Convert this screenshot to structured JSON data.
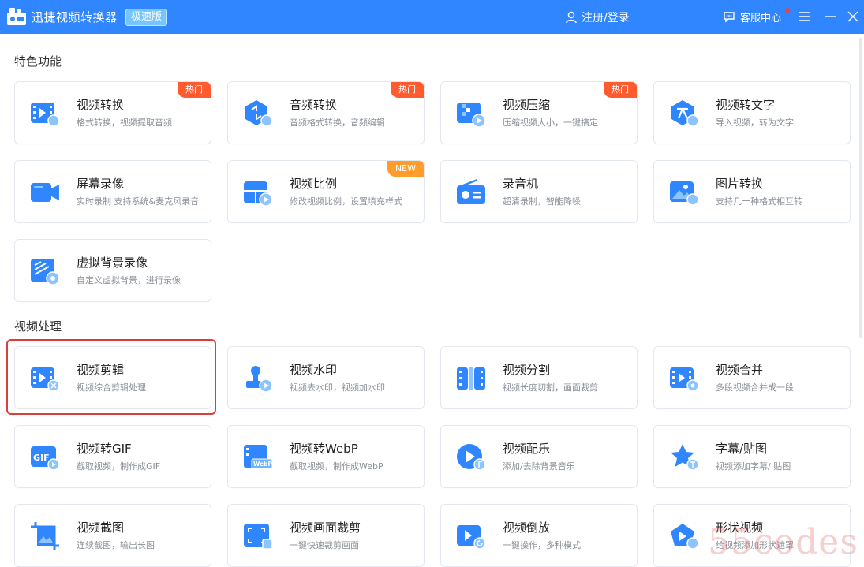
{
  "app": {
    "title": "迅捷视频转换器",
    "edition_badge": "极速版"
  },
  "header": {
    "login_label": "注册/登录",
    "support_label": "客服中心"
  },
  "sections": {
    "featured": "特色功能",
    "processing": "视频处理"
  },
  "tags": {
    "hot": "热门",
    "new": "NEW"
  },
  "featured": [
    {
      "title": "视频转换",
      "desc": "格式转换，视频提取音频"
    },
    {
      "title": "音频转换",
      "desc": "音频格式转换，音频编辑"
    },
    {
      "title": "视频压缩",
      "desc": "压缩视频大小，一键搞定"
    },
    {
      "title": "视频转文字",
      "desc": "导入视频，转为文字"
    },
    {
      "title": "屏幕录像",
      "desc": "实时录制 支持系统&麦克风录音"
    },
    {
      "title": "视频比例",
      "desc": "修改视频比例，设置填充样式"
    },
    {
      "title": "录音机",
      "desc": "超清录制，智能降噪"
    },
    {
      "title": "图片转换",
      "desc": "支持几十种格式相互转"
    },
    {
      "title": "虚拟背景录像",
      "desc": "自定义虚拟背景，进行录像"
    }
  ],
  "processing": [
    {
      "title": "视频剪辑",
      "desc": "视频综合剪辑处理"
    },
    {
      "title": "视频水印",
      "desc": "视频去水印，视频加水印"
    },
    {
      "title": "视频分割",
      "desc": "视频长度切割，画面裁剪"
    },
    {
      "title": "视频合并",
      "desc": "多段视频合并成一段"
    },
    {
      "title": "视频转GIF",
      "desc": "截取视频，制作成GIF"
    },
    {
      "title": "视频转WebP",
      "desc": "截取视频，制作成WebP"
    },
    {
      "title": "视频配乐",
      "desc": "添加/去除背景音乐"
    },
    {
      "title": "字幕/贴图",
      "desc": "视频添加字幕/ 贴图"
    },
    {
      "title": "视频截图",
      "desc": "连续截图，输出长图"
    },
    {
      "title": "视频画面裁剪",
      "desc": "一键快速裁剪画面"
    },
    {
      "title": "视频倒放",
      "desc": "一键操作，多种模式"
    },
    {
      "title": "形状视频",
      "desc": "给视频添加形状遮罩"
    }
  ],
  "icon_labels": {
    "gif": "GIF",
    "webp": "WebP"
  },
  "watermark": "55codes",
  "colors": {
    "brand": "#2f86ff",
    "hot": "#ff5b2e",
    "new": "#ff9c2b",
    "highlight": "#d9403b"
  }
}
